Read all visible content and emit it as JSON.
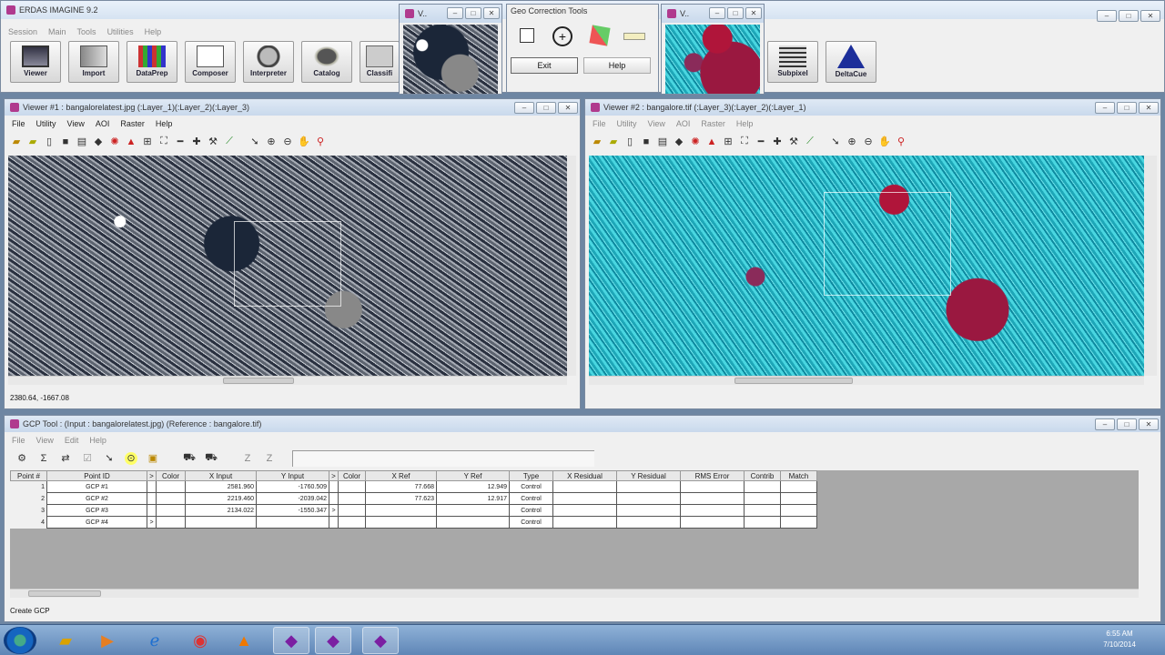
{
  "main": {
    "title": "ERDAS IMAGINE 9.2",
    "menu": [
      "Session",
      "Main",
      "Tools",
      "Utilities",
      "Help"
    ],
    "buttons": [
      {
        "label": "Viewer",
        "icon": "viewer-icon"
      },
      {
        "label": "Import",
        "icon": "import-icon"
      },
      {
        "label": "DataPrep",
        "icon": "dataprep-icon"
      },
      {
        "label": "Composer",
        "icon": "composer-icon"
      },
      {
        "label": "Interpreter",
        "icon": "interpreter-icon"
      },
      {
        "label": "Catalog",
        "icon": "catalog-icon"
      },
      {
        "label": "Classifi",
        "icon": "classifier-icon"
      },
      {
        "label": "Subpixel",
        "icon": "subpixel-icon"
      },
      {
        "label": "DeltaCue",
        "icon": "deltacue-icon"
      }
    ]
  },
  "small_viewer_1": {
    "title": "V.."
  },
  "small_viewer_2": {
    "title": "V.."
  },
  "geo_tools": {
    "title": "Geo Correction Tools",
    "exit": "Exit",
    "help": "Help"
  },
  "viewer1": {
    "title": "Viewer #1 : bangalorelatest.jpg (:Layer_1)(:Layer_2)(:Layer_3)",
    "menu": [
      "File",
      "Utility",
      "View",
      "AOI",
      "Raster",
      "Help"
    ],
    "status": "2380.64, -1667.08"
  },
  "viewer2": {
    "title": "Viewer #2 : bangalore.tif (:Layer_3)(:Layer_2)(:Layer_1)",
    "menu": [
      "File",
      "Utility",
      "View",
      "AOI",
      "Raster",
      "Help"
    ]
  },
  "gcp": {
    "title": "GCP Tool : (Input : bangalorelatest.jpg) (Reference : bangalore.tif)",
    "menu": [
      "File",
      "View",
      "Edit",
      "Help"
    ],
    "columns": [
      "Point #",
      "Point ID",
      ">",
      "Color",
      "X Input",
      "Y Input",
      ">",
      "Color",
      "X Ref",
      "Y Ref",
      "Type",
      "X Residual",
      "Y Residual",
      "RMS Error",
      "Contrib",
      "Match"
    ],
    "rows": [
      {
        "n": "1",
        "id": "GCP #1",
        "xin": "2581.960",
        "yin": "-1760.509",
        "xref": "77.668",
        "yref": "12.949",
        "type": "Control",
        "arrow": ""
      },
      {
        "n": "2",
        "id": "GCP #2",
        "xin": "2219.460",
        "yin": "-2039.042",
        "xref": "77.623",
        "yref": "12.917",
        "type": "Control",
        "arrow": ""
      },
      {
        "n": "3",
        "id": "GCP #3",
        "xin": "2134.022",
        "yin": "-1550.347",
        "xref": "",
        "yref": "",
        "type": "Control",
        "arrow": ">"
      },
      {
        "n": "4",
        "id": "GCP #4",
        "xin": "",
        "yin": "",
        "xref": "",
        "yref": "",
        "type": "Control",
        "arrow": ">"
      }
    ],
    "status": "Create GCP"
  },
  "clock": {
    "time": "6:55 AM",
    "date": "7/10/2014"
  }
}
